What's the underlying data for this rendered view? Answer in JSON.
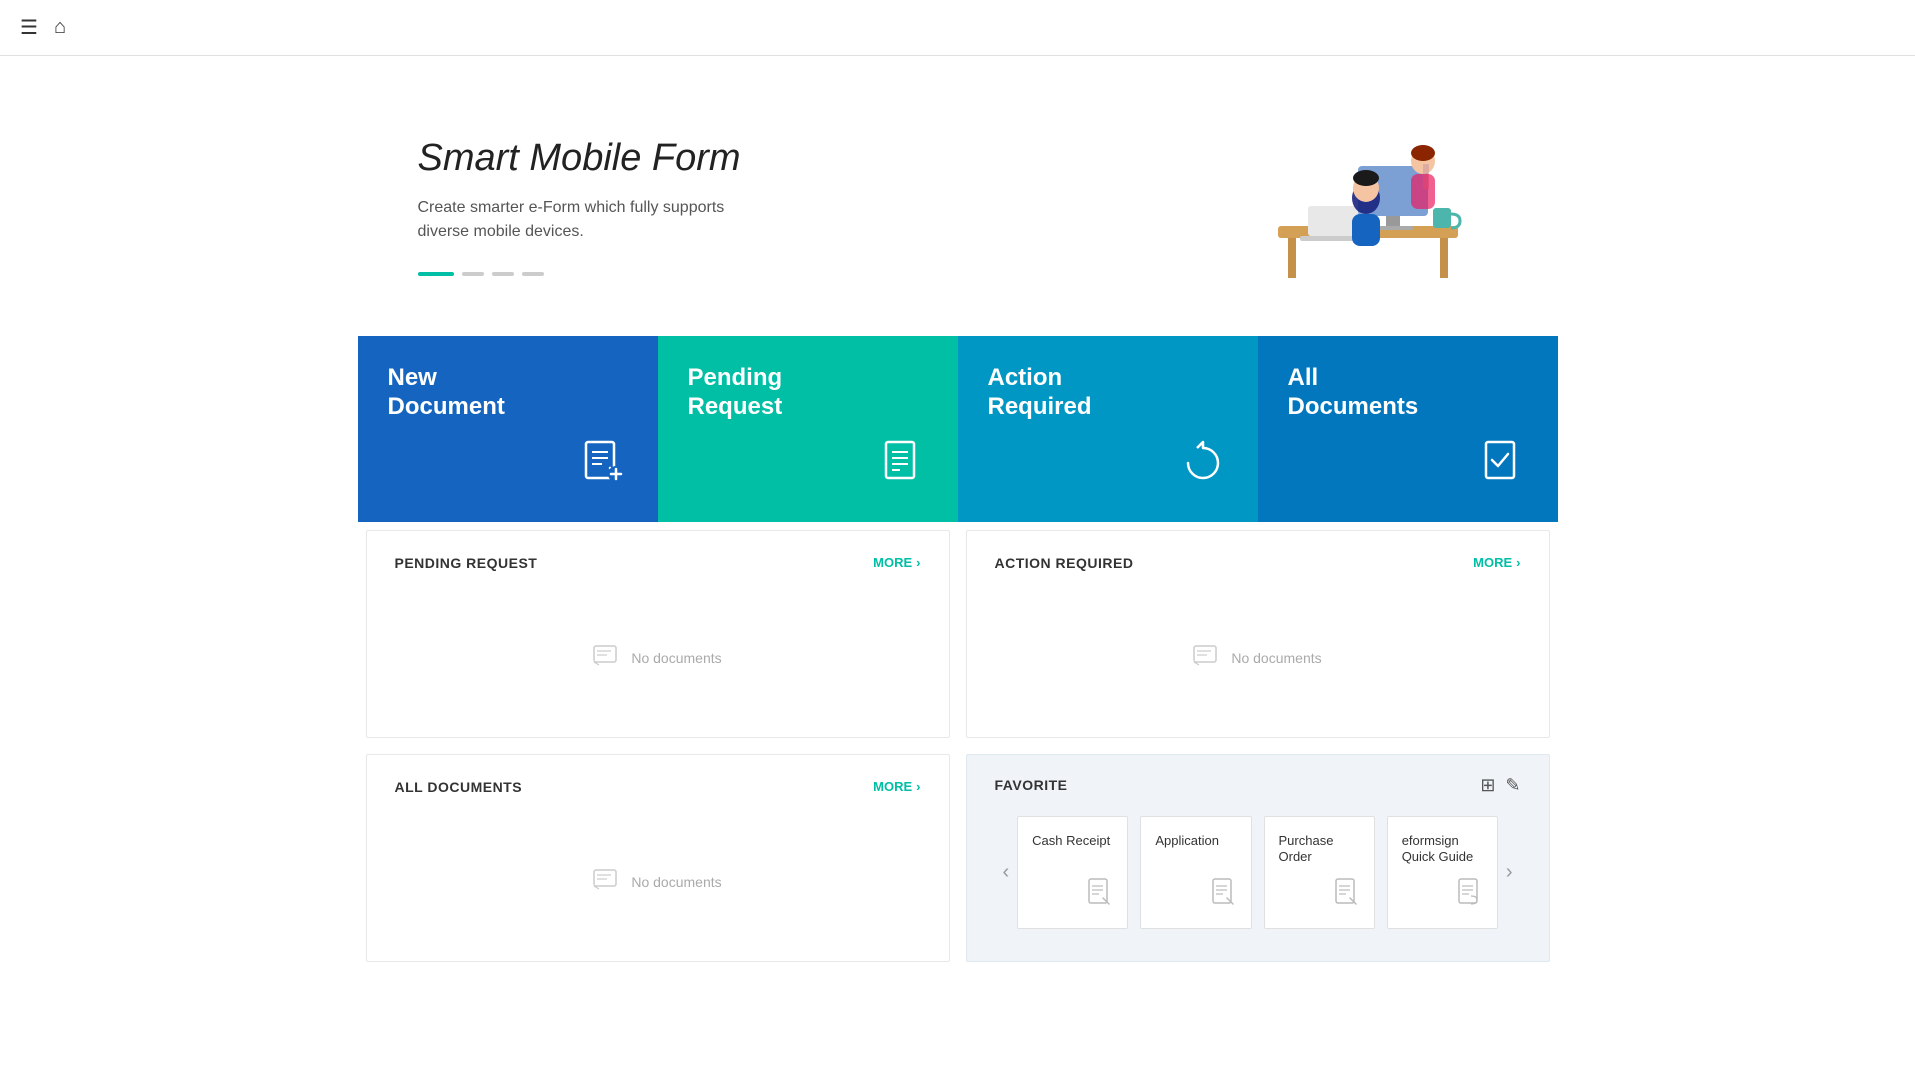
{
  "topbar": {
    "hamburger_icon": "☰",
    "home_icon": "⌂"
  },
  "hero": {
    "title": "Smart Mobile Form",
    "subtitle": "Create smarter e-Form which fully supports\ndiverse mobile devices.",
    "dots": [
      {
        "type": "active"
      },
      {
        "type": "inactive"
      },
      {
        "type": "inactive"
      },
      {
        "type": "inactive"
      }
    ]
  },
  "nav_tiles": [
    {
      "key": "new-document",
      "title": "New\nDocument",
      "title_line1": "New",
      "title_line2": "Document",
      "icon": "✎",
      "color_class": "tile-new-doc"
    },
    {
      "key": "pending-request",
      "title": "Pending\nRequest",
      "title_line1": "Pending",
      "title_line2": "Request",
      "icon": "≡",
      "color_class": "tile-pending"
    },
    {
      "key": "action-required",
      "title": "Action\nRequired",
      "title_line1": "Action",
      "title_line2": "Required",
      "icon": "↻",
      "color_class": "tile-action"
    },
    {
      "key": "all-documents",
      "title": "All\nDocuments",
      "title_line1": "All",
      "title_line2": "Documents",
      "icon": "☑",
      "color_class": "tile-all-docs"
    }
  ],
  "pending_request": {
    "title": "PENDING REQUEST",
    "more_label": "MORE",
    "no_docs_text": "No documents"
  },
  "action_required": {
    "title": "ACTION REQUIRED",
    "more_label": "MORE",
    "no_docs_text": "No documents"
  },
  "all_documents": {
    "title": "ALL DOCUMENTS",
    "more_label": "MORE",
    "no_docs_text": "No documents"
  },
  "favorite": {
    "title": "FAVORITE",
    "add_icon": "⊞",
    "edit_icon": "✎",
    "prev_arrow": "‹",
    "next_arrow": "›",
    "items": [
      {
        "name": "Cash Receipt",
        "icon": "📄"
      },
      {
        "name": "Application",
        "icon": "📄"
      },
      {
        "name": "Purchase Order",
        "icon": "📄"
      },
      {
        "name": "eformsign Quick Guide",
        "icon": "📄"
      }
    ]
  }
}
